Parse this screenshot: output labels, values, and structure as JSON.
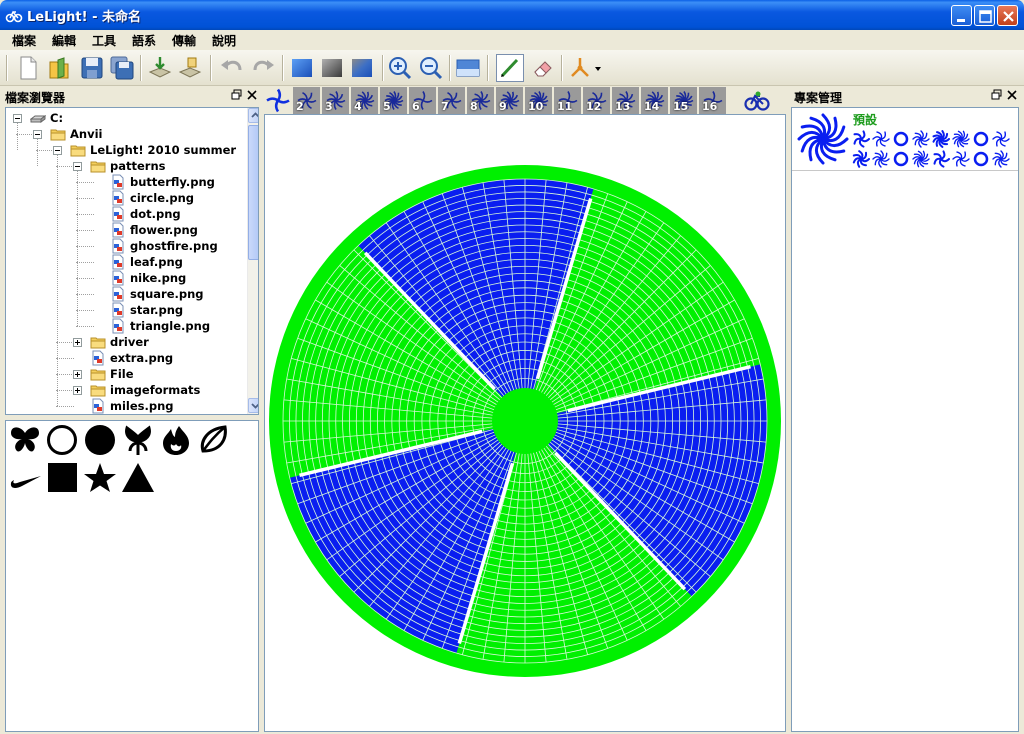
{
  "window": {
    "title": "LeLight! - 未命名"
  },
  "menu": [
    "檔案",
    "編輯",
    "工具",
    "語系",
    "傳輸",
    "說明"
  ],
  "panels": {
    "file_browser": "檔案瀏覽器",
    "project_manager": "專案管理"
  },
  "tree": [
    {
      "label": "C:",
      "kind": "drive",
      "depth": 0,
      "expanded": true
    },
    {
      "label": "Anvii",
      "kind": "folder",
      "depth": 1,
      "expanded": true
    },
    {
      "label": "LeLight! 2010 summer",
      "kind": "folder",
      "depth": 2,
      "expanded": true
    },
    {
      "label": "patterns",
      "kind": "folder",
      "depth": 3,
      "expanded": true
    },
    {
      "label": "butterfly.png",
      "kind": "file",
      "depth": 4
    },
    {
      "label": "circle.png",
      "kind": "file",
      "depth": 4
    },
    {
      "label": "dot.png",
      "kind": "file",
      "depth": 4
    },
    {
      "label": "flower.png",
      "kind": "file",
      "depth": 4
    },
    {
      "label": "ghostfire.png",
      "kind": "file",
      "depth": 4
    },
    {
      "label": "leaf.png",
      "kind": "file",
      "depth": 4
    },
    {
      "label": "nike.png",
      "kind": "file",
      "depth": 4
    },
    {
      "label": "square.png",
      "kind": "file",
      "depth": 4
    },
    {
      "label": "star.png",
      "kind": "file",
      "depth": 4
    },
    {
      "label": "triangle.png",
      "kind": "file",
      "depth": 4
    },
    {
      "label": "driver",
      "kind": "folder",
      "depth": 3,
      "expanded": false
    },
    {
      "label": "extra.png",
      "kind": "file",
      "depth": 3
    },
    {
      "label": "File",
      "kind": "folder",
      "depth": 3,
      "expanded": false
    },
    {
      "label": "imageformats",
      "kind": "folder",
      "depth": 3,
      "expanded": false
    },
    {
      "label": "miles.png",
      "kind": "file",
      "depth": 3
    }
  ],
  "shapes": [
    "butterfly-icon",
    "circle-icon",
    "dot-icon",
    "flower-icon",
    "ghostfire-icon",
    "leaf-icon",
    "nike-icon",
    "square-icon",
    "star-icon",
    "triangle-icon"
  ],
  "pattern_tabs": [
    "",
    "2",
    "3",
    "4",
    "5",
    "6",
    "7",
    "8",
    "9",
    "10",
    "11",
    "12",
    "13",
    "14",
    "15",
    "16"
  ],
  "project": {
    "default_label": "預設"
  },
  "colors": {
    "accent_blue": "#0a1ef0",
    "wheel_green": "#00f000",
    "grid_line": "#d8f8d8"
  },
  "wheel": {
    "sectors": 6,
    "rings": 28,
    "spokes": 72,
    "highlighted_sectors": [
      0,
      2,
      4
    ]
  }
}
